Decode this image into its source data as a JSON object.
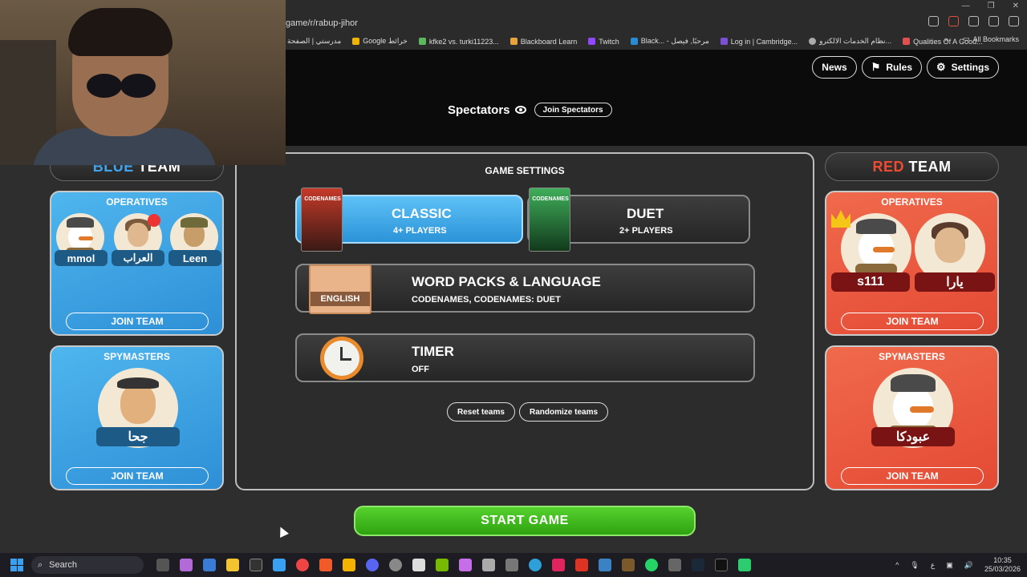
{
  "browser": {
    "url": "game/r/rabup-jihor",
    "bookmarks": [
      "مدرستي | الصفحة",
      "Google خرائط",
      "kfke2 vs. turki11223...",
      "Blackboard Learn",
      "Twitch",
      "Black... - مرحبًا, فيصل",
      "Log in | Cambridge...",
      "نظام الخدمات الالكترو...",
      "Qualities Of A Good..."
    ],
    "all_bookmarks": "All Bookmarks"
  },
  "header": {
    "news": "News",
    "rules": "Rules",
    "settings": "Settings"
  },
  "spectators": {
    "label": "Spectators",
    "join": "Join Spectators"
  },
  "blue_team": {
    "title_color_word": "BLUE",
    "title_rest": "TEAM",
    "operatives_label": "OPERATIVES",
    "operatives": [
      "mmol",
      "العراب",
      "Leen"
    ],
    "spymasters_label": "SPYMASTERS",
    "spymasters": [
      "جحا"
    ],
    "join_operatives": "JOIN TEAM",
    "join_spymasters": "JOIN TEAM"
  },
  "red_team": {
    "title_color_word": "RED",
    "title_rest": "TEAM",
    "operatives_label": "OPERATIVES",
    "operatives": [
      "s111",
      "يارا"
    ],
    "spymasters_label": "SPYMASTERS",
    "spymasters": [
      "عبودكا"
    ],
    "join_operatives": "JOIN TEAM",
    "join_spymasters": "JOIN TEAM"
  },
  "game_settings": {
    "title": "GAME SETTINGS",
    "classic": {
      "title": "CLASSIC",
      "subtitle": "4+ PLAYERS",
      "box_text": "CODENAMES"
    },
    "duet": {
      "title": "DUET",
      "subtitle": "2+ PLAYERS",
      "box_text": "CODENAMES"
    },
    "word_packs": {
      "title": "WORD PACKS & LANGUAGE",
      "subtitle": "CODENAMES, CODENAMES: DUET",
      "flag_text": "ENGLISH"
    },
    "timer": {
      "title": "TIMER",
      "subtitle": "OFF"
    },
    "reset_teams": "Reset teams",
    "randomize_teams": "Randomize teams"
  },
  "start_game": "START GAME",
  "taskbar": {
    "search": "Search",
    "time": "10:35",
    "date": "25/03/2026",
    "lang": "ع"
  },
  "colors": {
    "blue_accent": "#2e8fd6",
    "red_accent": "#e44a34",
    "start_green": "#3fb81e"
  }
}
